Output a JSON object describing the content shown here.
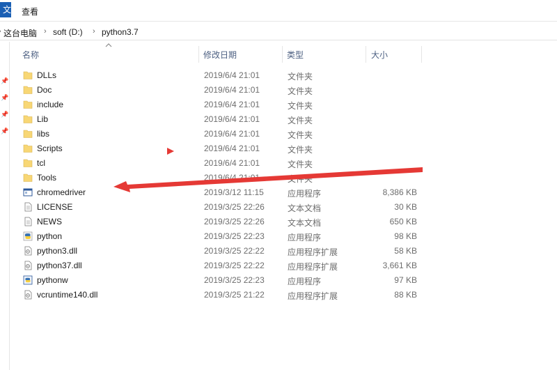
{
  "ribbon": {
    "file_tab": "文",
    "view_tab": "查看"
  },
  "address": {
    "crumbs": [
      "这台电脑",
      "soft (D:)",
      "python3.7"
    ],
    "separator": "›"
  },
  "columns": {
    "name": "名称",
    "date": "修改日期",
    "type": "类型",
    "size": "大小"
  },
  "files": [
    {
      "name": "DLLs",
      "date": "2019/6/4 21:01",
      "type": "文件夹",
      "size": "",
      "icon": "folder-icon"
    },
    {
      "name": "Doc",
      "date": "2019/6/4 21:01",
      "type": "文件夹",
      "size": "",
      "icon": "folder-icon"
    },
    {
      "name": "include",
      "date": "2019/6/4 21:01",
      "type": "文件夹",
      "size": "",
      "icon": "folder-icon"
    },
    {
      "name": "Lib",
      "date": "2019/6/4 21:01",
      "type": "文件夹",
      "size": "",
      "icon": "folder-icon"
    },
    {
      "name": "libs",
      "date": "2019/6/4 21:01",
      "type": "文件夹",
      "size": "",
      "icon": "folder-icon"
    },
    {
      "name": "Scripts",
      "date": "2019/6/4 21:01",
      "type": "文件夹",
      "size": "",
      "icon": "folder-icon"
    },
    {
      "name": "tcl",
      "date": "2019/6/4 21:01",
      "type": "文件夹",
      "size": "",
      "icon": "folder-icon"
    },
    {
      "name": "Tools",
      "date": "2019/6/4 21:01",
      "type": "文件夹",
      "size": "",
      "icon": "folder-icon"
    },
    {
      "name": "chromedriver",
      "date": "2019/3/12 11:15",
      "type": "应用程序",
      "size": "8,386 KB",
      "icon": "application-icon"
    },
    {
      "name": "LICENSE",
      "date": "2019/3/25 22:26",
      "type": "文本文档",
      "size": "30 KB",
      "icon": "text-document-icon"
    },
    {
      "name": "NEWS",
      "date": "2019/3/25 22:26",
      "type": "文本文档",
      "size": "650 KB",
      "icon": "text-document-icon"
    },
    {
      "name": "python",
      "date": "2019/3/25 22:23",
      "type": "应用程序",
      "size": "98 KB",
      "icon": "python-icon"
    },
    {
      "name": "python3.dll",
      "date": "2019/3/25 22:22",
      "type": "应用程序扩展",
      "size": "58 KB",
      "icon": "dll-icon"
    },
    {
      "name": "python37.dll",
      "date": "2019/3/25 22:22",
      "type": "应用程序扩展",
      "size": "3,661 KB",
      "icon": "dll-icon"
    },
    {
      "name": "pythonw",
      "date": "2019/3/25 22:23",
      "type": "应用程序",
      "size": "97 KB",
      "icon": "pythonw-icon"
    },
    {
      "name": "vcruntime140.dll",
      "date": "2019/3/25 21:22",
      "type": "应用程序扩展",
      "size": "88 KB",
      "icon": "dll-icon"
    }
  ],
  "colors": {
    "annotation_red": "#e53935",
    "folder": "#f8d775",
    "header_text": "#4d6082",
    "ribbon_blue": "#1a5fb4"
  }
}
